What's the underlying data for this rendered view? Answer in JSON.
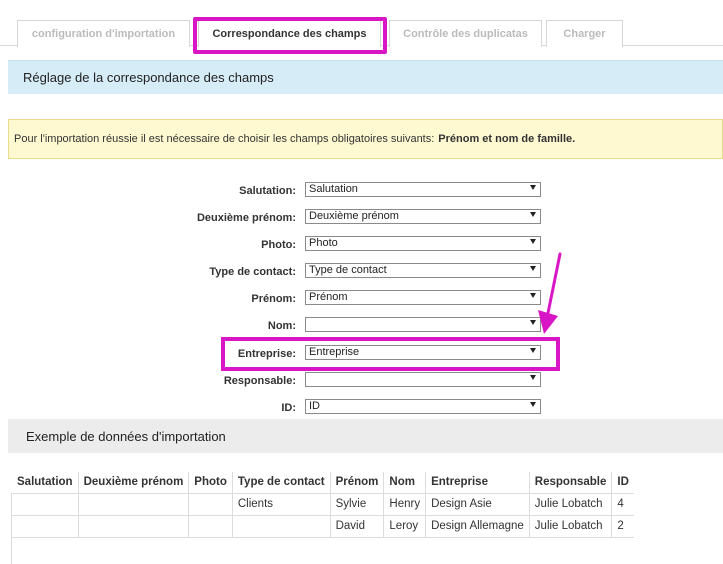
{
  "tabs": [
    {
      "label": "configuration d'importation",
      "active": false
    },
    {
      "label": "Correspondance des champs",
      "active": true
    },
    {
      "label": "Contrôle des duplicatas",
      "active": false
    },
    {
      "label": "Charger",
      "active": false
    }
  ],
  "mapping_section": {
    "title": "Réglage de la correspondance des champs"
  },
  "notice": {
    "text": "Pour l'importation réussie il est nécessaire de choisir les champs obligatoires suivants:",
    "required": "Prénom et nom de famille."
  },
  "fields": [
    {
      "label": "Salutation:",
      "value": "Salutation"
    },
    {
      "label": "Deuxième prénom:",
      "value": "Deuxième prénom"
    },
    {
      "label": "Photo:",
      "value": "Photo"
    },
    {
      "label": "Type de contact:",
      "value": "Type de contact"
    },
    {
      "label": "Prénom:",
      "value": "Prénom"
    },
    {
      "label": "Nom:",
      "value": ""
    },
    {
      "label": "Entreprise:",
      "value": "Entreprise"
    },
    {
      "label": "Responsable:",
      "value": ""
    },
    {
      "label": "ID:",
      "value": "ID"
    }
  ],
  "preview_section": {
    "title": "Exemple de données d'importation"
  },
  "preview_table": {
    "headers": [
      "Salutation",
      "Deuxième prénom",
      "Photo",
      "Type de contact",
      "Prénom",
      "Nom",
      "Entreprise",
      "Responsable",
      "ID"
    ],
    "rows": [
      [
        "",
        "",
        "",
        "Clients",
        "Sylvie",
        "Henry",
        "Design Asie",
        "Julie Lobatch",
        "4"
      ],
      [
        "",
        "",
        "",
        "",
        "David",
        "Leroy",
        "Design Allemagne",
        "Julie Lobatch",
        "2"
      ]
    ]
  },
  "colors": {
    "highlight": "#d816c6",
    "header_blue": "#d6ecf7",
    "notice_bg": "#fff9d1"
  }
}
